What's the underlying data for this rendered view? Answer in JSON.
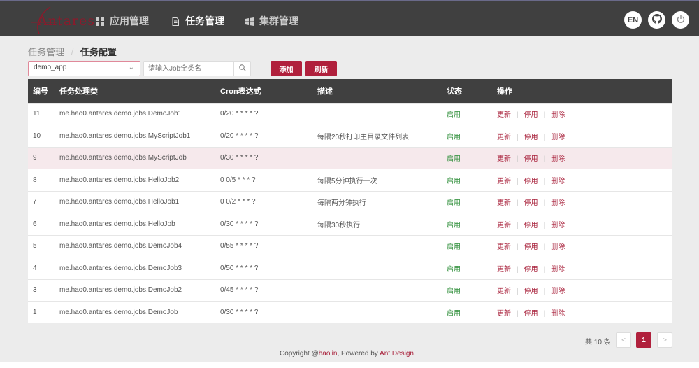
{
  "header": {
    "logo": "Antares",
    "nav": [
      {
        "label": "应用管理",
        "icon": "grid-icon"
      },
      {
        "label": "任务管理",
        "icon": "file-icon",
        "active": true
      },
      {
        "label": "集群管理",
        "icon": "windows-icon"
      }
    ],
    "lang": "EN"
  },
  "breadcrumb": [
    "任务管理",
    "任务配置"
  ],
  "toolbar": {
    "app_select": "demo_app",
    "search_placeholder": "请输入Job全类名",
    "add": "添加",
    "refresh": "刷新"
  },
  "table": {
    "headers": [
      "编号",
      "任务处理类",
      "Cron表达式",
      "描述",
      "状态",
      "操作"
    ],
    "actions": [
      "更新",
      "停用",
      "删除"
    ],
    "rows": [
      {
        "id": "11",
        "cls": "me.hao0.antares.demo.jobs.DemoJob1",
        "cron": "0/20 * * * * ?",
        "desc": "",
        "status": "启用"
      },
      {
        "id": "10",
        "cls": "me.hao0.antares.demo.jobs.MyScriptJob1",
        "cron": "0/20 * * * * ?",
        "desc": "每隔20秒打印主目录文件列表",
        "status": "启用"
      },
      {
        "id": "9",
        "cls": "me.hao0.antares.demo.jobs.MyScriptJob",
        "cron": "0/30 * * * * ?",
        "desc": "",
        "status": "启用"
      },
      {
        "id": "8",
        "cls": "me.hao0.antares.demo.jobs.HelloJob2",
        "cron": "0 0/5 * * * ?",
        "desc": "每隔5分钟执行一次",
        "status": "启用"
      },
      {
        "id": "7",
        "cls": "me.hao0.antares.demo.jobs.HelloJob1",
        "cron": "0 0/2 * * * ?",
        "desc": "每隔两分钟执行",
        "status": "启用"
      },
      {
        "id": "6",
        "cls": "me.hao0.antares.demo.jobs.HelloJob",
        "cron": "0/30 * * * * ?",
        "desc": "每隔30秒执行",
        "status": "启用"
      },
      {
        "id": "5",
        "cls": "me.hao0.antares.demo.jobs.DemoJob4",
        "cron": "0/55 * * * * ?",
        "desc": "",
        "status": "启用"
      },
      {
        "id": "4",
        "cls": "me.hao0.antares.demo.jobs.DemoJob3",
        "cron": "0/50 * * * * ?",
        "desc": "",
        "status": "启用"
      },
      {
        "id": "3",
        "cls": "me.hao0.antares.demo.jobs.DemoJob2",
        "cron": "0/45 * * * * ?",
        "desc": "",
        "status": "启用"
      },
      {
        "id": "1",
        "cls": "me.hao0.antares.demo.jobs.DemoJob",
        "cron": "0/30 * * * * ?",
        "desc": "",
        "status": "启用"
      }
    ]
  },
  "pagination": {
    "total": "共 10 条",
    "current": "1",
    "prev": "<",
    "next": ">"
  },
  "footer": {
    "pre": "Copyright  @",
    "author": "haolin",
    "mid": ", Powered by ",
    "link": "Ant Design",
    "end": "."
  }
}
